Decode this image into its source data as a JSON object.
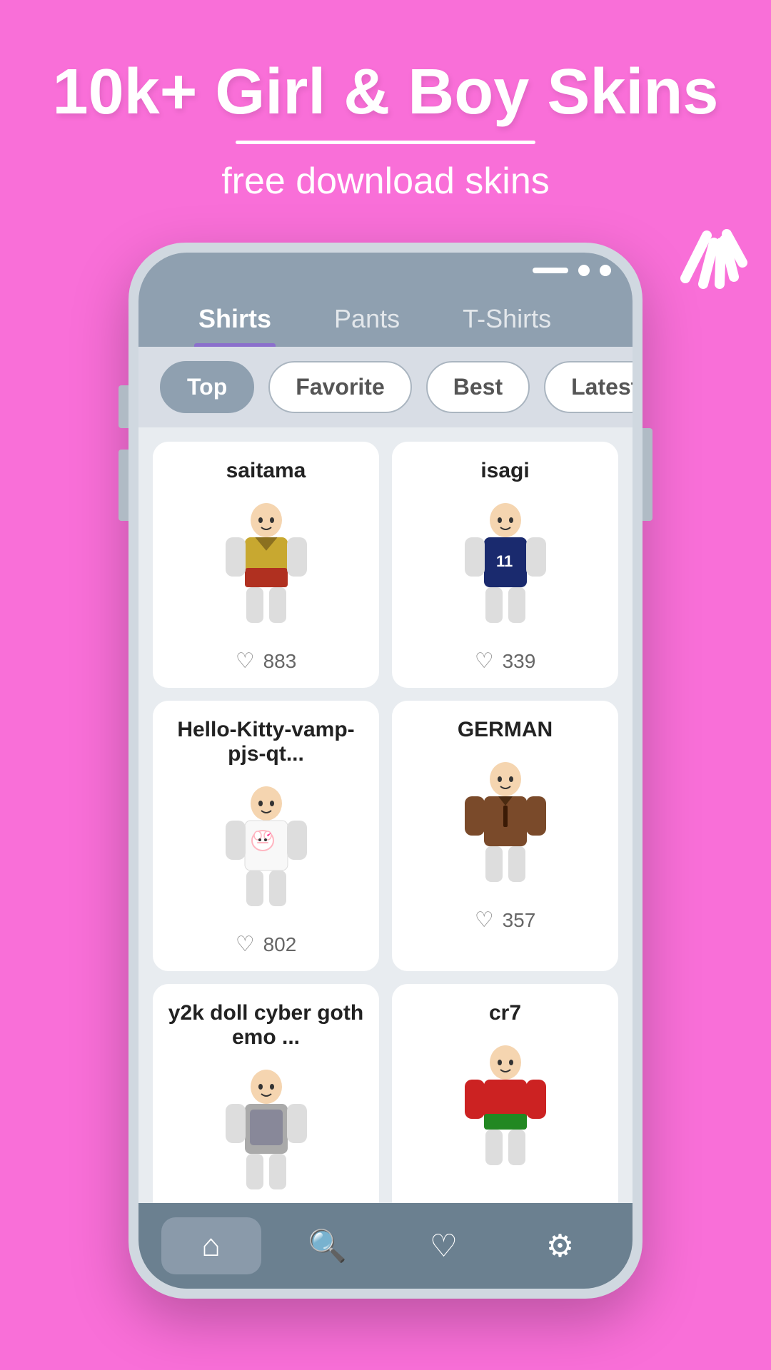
{
  "app": {
    "header_title": "10k+ Girl & Boy Skins",
    "header_subtitle": "free download skins",
    "shine_label": "shine-decoration"
  },
  "tabs": [
    {
      "id": "shirts",
      "label": "Shirts",
      "active": true
    },
    {
      "id": "pants",
      "label": "Pants",
      "active": false
    },
    {
      "id": "tshirts",
      "label": "T-Shirts",
      "active": false
    }
  ],
  "filters": [
    {
      "id": "top",
      "label": "Top",
      "active": true
    },
    {
      "id": "favorite",
      "label": "Favorite",
      "active": false
    },
    {
      "id": "best",
      "label": "Best",
      "active": false
    },
    {
      "id": "latest",
      "label": "Latest",
      "active": false
    }
  ],
  "cards": [
    {
      "id": "saitama",
      "title": "saitama",
      "likes": "883",
      "color1": "#c8a830",
      "color2": "#b03020"
    },
    {
      "id": "isagi",
      "title": "isagi",
      "likes": "339",
      "color1": "#1a2a6e",
      "color2": "#2244aa"
    },
    {
      "id": "hello-kitty",
      "title": "Hello-Kitty-vamp-pjs-qt...",
      "likes": "802",
      "color1": "#f0f0f0",
      "color2": "#ffb6c1"
    },
    {
      "id": "german",
      "title": "GERMAN",
      "likes": "357",
      "color1": "#7a4a2a",
      "color2": "#5a3a1a"
    },
    {
      "id": "y2k",
      "title": "y2k doll cyber goth emo ...",
      "likes": "",
      "color1": "#cccccc",
      "color2": "#9999aa"
    },
    {
      "id": "cr7",
      "title": "cr7",
      "likes": "",
      "color1": "#cc2222",
      "color2": "#228822"
    }
  ],
  "bottom_nav": [
    {
      "id": "home",
      "icon": "⌂",
      "active": true
    },
    {
      "id": "search",
      "icon": "⌕",
      "active": false
    },
    {
      "id": "favorites",
      "icon": "♡",
      "active": false
    },
    {
      "id": "settings",
      "icon": "⚙",
      "active": false
    }
  ]
}
